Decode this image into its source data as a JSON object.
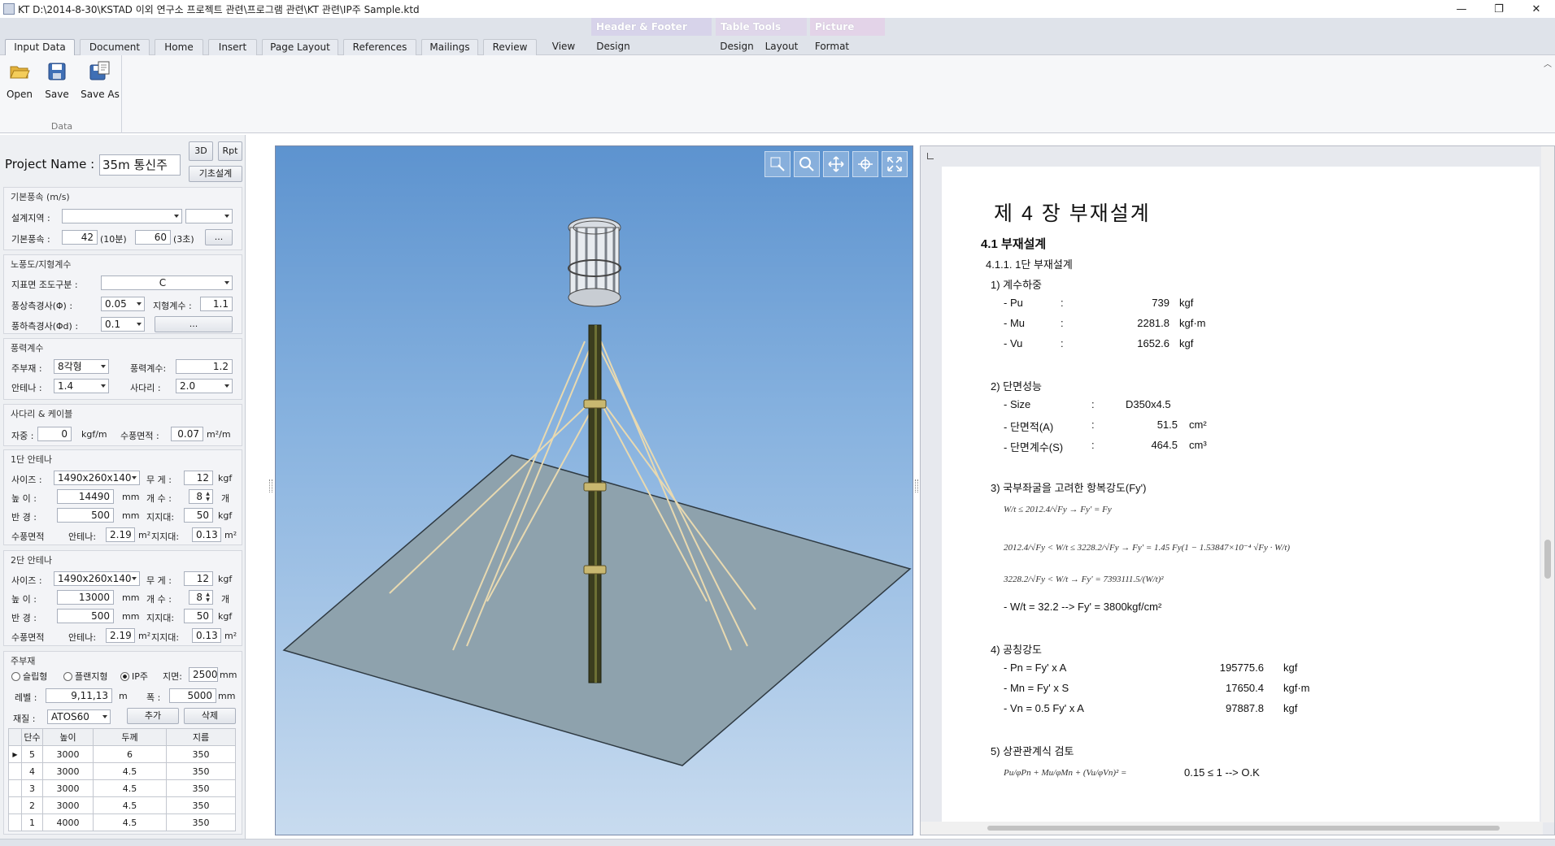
{
  "window": {
    "title": "KT D:\\2014-8-30\\KSTAD 이외 연구소 프로젝트 관련\\프로그램 관련\\KT 관련\\IP주 Sample.ktd"
  },
  "ribbon": {
    "context_headers": [
      "Header & Footer Tools",
      "Table Tools",
      "Picture Tools"
    ],
    "tabs": [
      "Input Data",
      "Document",
      "Home",
      "Insert",
      "Page Layout",
      "References",
      "Mailings",
      "Review",
      "View",
      "Design",
      "Design",
      "Layout",
      "Format"
    ],
    "buttons": {
      "open": "Open",
      "save": "Save",
      "save_as": "Save As"
    },
    "group_label": "Data"
  },
  "left": {
    "project_label": "Project Name :",
    "project_name": "35m 통신주",
    "btn_3d": "3D",
    "btn_rpt": "Rpt",
    "btn_foundation": "기초설계",
    "wind": {
      "title": "기본풍속 (m/s)",
      "region_label": "설계지역 :",
      "region_value": "",
      "region_value2": "",
      "speed_label": "기본풍속 :",
      "speed10": "42",
      "speed10_unit": "(10분)",
      "speed3": "60",
      "speed3_unit": "(3초)",
      "more": "..."
    },
    "exposure": {
      "title": "노풍도/지형계수",
      "roughness_label": "지표면 조도구분 :",
      "roughness_value": "C",
      "slope_up_label": "풍상측경사(Φ) :",
      "slope_up_value": "0.05",
      "topo_label": "지형계수 :",
      "topo_value": "1.1",
      "slope_down_label": "풍하측경사(Φd) :",
      "slope_down_value": "0.1",
      "more": "..."
    },
    "force": {
      "title": "풍력계수",
      "main_label": "주부재 :",
      "main_value": "8각형",
      "coef_label": "풍력계수:",
      "coef_value": "1.2",
      "antenna_label": "안테나 :",
      "antenna_value": "1.4",
      "ladder_label": "사다리 :",
      "ladder_value": "2.0"
    },
    "ladder": {
      "title": "사다리 & 케이블",
      "weight_label": "자중 :",
      "weight_value": "0",
      "weight_unit": "kgf/m",
      "area_label": "수풍면적 :",
      "area_value": "0.07",
      "area_unit": "m²/m"
    },
    "antenna1": {
      "title": "1단 안테나",
      "size_label": "사이즈 :",
      "size_value": "1490x260x140",
      "wt_label": "무 게 :",
      "wt_value": "12",
      "wt_unit": "kgf",
      "h_label": "높 이 :",
      "h_value": "14490",
      "h_unit": "mm",
      "n_label": "개 수 :",
      "n_value": "8",
      "n_unit": "개",
      "r_label": "반 경 :",
      "r_value": "500",
      "r_unit": "mm",
      "sup_label": "지지대:",
      "sup_value": "50",
      "sup_unit": "kgf",
      "area_label": "수풍면적",
      "ant_label": "안테나:",
      "ant_value": "2.19",
      "ant_unit": "m²",
      "sup2_label": "지지대:",
      "sup2_value": "0.13",
      "sup2_unit": "m²"
    },
    "antenna2": {
      "title": "2단 안테나",
      "size_label": "사이즈 :",
      "size_value": "1490x260x140",
      "wt_label": "무 게 :",
      "wt_value": "12",
      "wt_unit": "kgf",
      "h_label": "높 이 :",
      "h_value": "13000",
      "h_unit": "mm",
      "n_label": "개 수 :",
      "n_value": "8",
      "n_unit": "개",
      "r_label": "반 경 :",
      "r_value": "500",
      "r_unit": "mm",
      "sup_label": "지지대:",
      "sup_value": "50",
      "sup_unit": "kgf",
      "area_label": "수풍면적",
      "ant_label": "안테나:",
      "ant_value": "2.19",
      "ant_unit": "m²",
      "sup2_label": "지지대:",
      "sup2_value": "0.13",
      "sup2_unit": "m²"
    },
    "member": {
      "title": "주부재",
      "opt1": "슬립형",
      "opt2": "플랜지형",
      "opt3": "IP주",
      "ground_label": "지면:",
      "ground_value": "2500",
      "ground_unit": "mm",
      "level_label": "레벨 :",
      "level_value": "9,11,13",
      "level_unit": "m",
      "width_label": "폭 :",
      "width_value": "5000",
      "width_unit": "mm",
      "mat_label": "재질 :",
      "mat_value": "ATOS60",
      "add": "추가",
      "del": "삭제",
      "columns": [
        "단수",
        "높이",
        "두께",
        "지름"
      ],
      "rows": [
        [
          "5",
          "3000",
          "6",
          "350"
        ],
        [
          "4",
          "3000",
          "4.5",
          "350"
        ],
        [
          "3",
          "3000",
          "4.5",
          "350"
        ],
        [
          "2",
          "3000",
          "4.5",
          "350"
        ],
        [
          "1",
          "4000",
          "4.5",
          "350"
        ]
      ]
    }
  },
  "doc": {
    "chapter": "제 4 장  부재설계",
    "section": "4.1 부재설계",
    "subsection": "4.1.1. 1단 부재설계",
    "s1": "1) 계수하중",
    "pu": {
      "label": "- Pu",
      "colon": ":",
      "value": "739",
      "unit": "kgf"
    },
    "mu": {
      "label": "- Mu",
      "colon": ":",
      "value": "2281.8",
      "unit": "kgf·m"
    },
    "vu": {
      "label": "- Vu",
      "colon": ":",
      "value": "1652.6",
      "unit": "kgf"
    },
    "s2": "2) 단면성능",
    "size": {
      "label": "- Size",
      "colon": ":",
      "value": "D350x4.5"
    },
    "area": {
      "label": "- 단면적(A)",
      "colon": ":",
      "value": "51.5",
      "unit": "cm²"
    },
    "modulus": {
      "label": "- 단면계수(S)",
      "colon": ":",
      "value": "464.5",
      "unit": "cm³"
    },
    "s3": "3) 국부좌굴을 고려한 항복강도(Fy')",
    "f1": "W/t ≤ 2012.4/√Fy  → Fy' = Fy",
    "f2": "2012.4/√Fy < W/t ≤ 3228.2/√Fy  → Fy' = 1.45 Fy(1 − 1.53847×10⁻⁴ √Fy · W/t)",
    "f3": "3228.2/√Fy < W/t  → Fy' = 7393111.5/(W/t)²",
    "f4": "- W/t = 32.2 --> Fy' = 3800kgf/cm²",
    "s4": "4) 공칭강도",
    "pn": {
      "label": "- Pn  = Fy' x A",
      "value": "195775.6",
      "unit": "kgf"
    },
    "mn": {
      "label": "- Mn  = Fy' x S",
      "value": "17650.4",
      "unit": "kgf·m"
    },
    "vn": {
      "label": "- Vn  = 0.5 Fy' x A",
      "value": "97887.8",
      "unit": "kgf"
    },
    "s5": "5) 상관관계식 검토",
    "f5": "Pu/φPn + Mu/φMn + (Vu/φVn)² =",
    "result": "0.15 ≤ 1 --> O.K"
  }
}
